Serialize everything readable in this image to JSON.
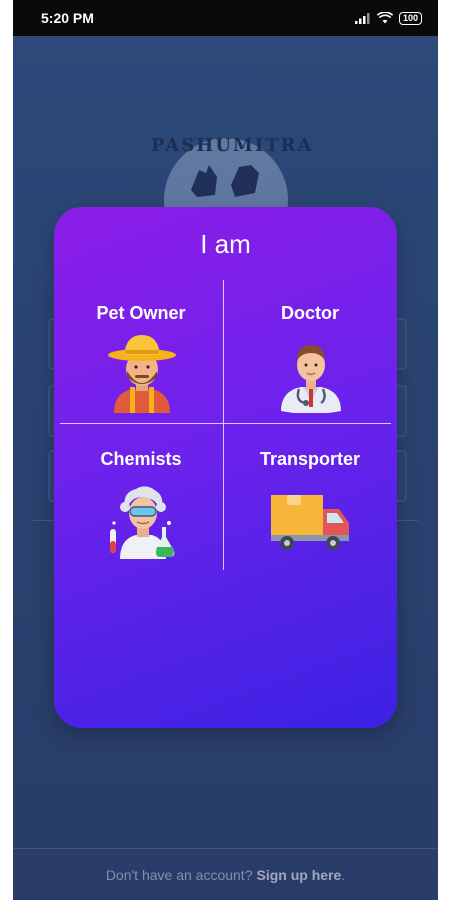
{
  "status_bar": {
    "time": "5:20 PM",
    "battery": "100",
    "icons": [
      "signal-icon",
      "wifi-icon",
      "battery-icon"
    ]
  },
  "background": {
    "logo_text": "PASHUMITRA"
  },
  "modal": {
    "title": "I am",
    "options": [
      {
        "label": "Pet Owner",
        "icon": "farmer-icon"
      },
      {
        "label": "Doctor",
        "icon": "doctor-icon"
      },
      {
        "label": "Chemists",
        "icon": "chemist-icon"
      },
      {
        "label": "Transporter",
        "icon": "truck-icon"
      }
    ]
  },
  "footer": {
    "prompt": "Don't have an account?",
    "link": "Sign up here",
    "suffix": "."
  },
  "colors": {
    "modal_gradient_start": "#8d1de8",
    "modal_gradient_end": "#3b22e3",
    "background": "#2a4270"
  }
}
